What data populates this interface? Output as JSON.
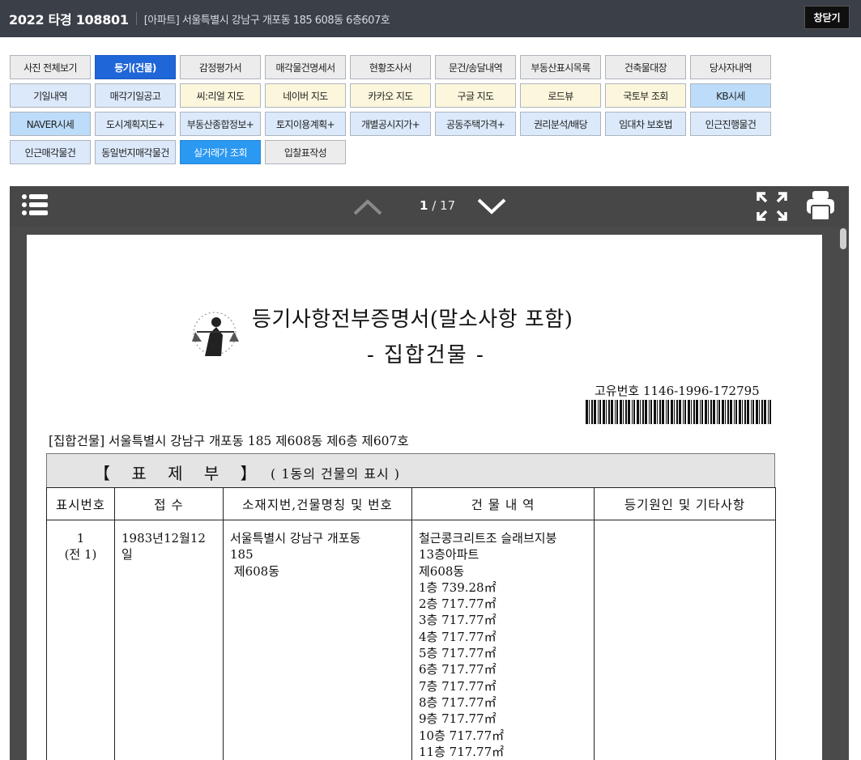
{
  "header": {
    "case_no": "2022 타경 108801",
    "address": "[아파트] 서울특별시 강남구 개포동 185 608동 6층607호",
    "close_label": "창닫기"
  },
  "menu": {
    "rows": [
      [
        {
          "label": "사진 전체보기",
          "style": "plain"
        },
        {
          "label": "등기(건물)",
          "style": "active"
        },
        {
          "label": "감정평가서",
          "style": "plain"
        },
        {
          "label": "매각물건명세서",
          "style": "plain"
        },
        {
          "label": "현황조사서",
          "style": "plain"
        },
        {
          "label": "문건/송달내역",
          "style": "plain"
        },
        {
          "label": "부동산표시목록",
          "style": "plain"
        },
        {
          "label": "건축물대장",
          "style": "plain"
        },
        {
          "label": "당사자내역",
          "style": "plain"
        }
      ],
      [
        {
          "label": "기일내역",
          "style": "blue"
        },
        {
          "label": "매각기일공고",
          "style": "blue"
        },
        {
          "label": "씨:리얼 지도",
          "style": "yellow"
        },
        {
          "label": "네이버 지도",
          "style": "yellow"
        },
        {
          "label": "카카오 지도",
          "style": "yellow"
        },
        {
          "label": "구글 지도",
          "style": "yellow"
        },
        {
          "label": "로드뷰",
          "style": "yellow"
        },
        {
          "label": "국토부 조회",
          "style": "yellow"
        },
        {
          "label": "KB시세",
          "style": "sky"
        }
      ],
      [
        {
          "label": "NAVER시세",
          "style": "sky"
        },
        {
          "label": "도시계획지도+",
          "style": "blue"
        },
        {
          "label": "부동산종합정보+",
          "style": "blue"
        },
        {
          "label": "토지이용계획+",
          "style": "blue"
        },
        {
          "label": "개별공시지가+",
          "style": "blue"
        },
        {
          "label": "공동주택가격+",
          "style": "blue"
        },
        {
          "label": "권리분석/배당",
          "style": "blue"
        },
        {
          "label": "임대차 보호법",
          "style": "blue"
        },
        {
          "label": "인근진행물건",
          "style": "blue"
        }
      ],
      [
        {
          "label": "인근매각물건",
          "style": "blue"
        },
        {
          "label": "동일번지매각물건",
          "style": "blue"
        },
        {
          "label": "실거래가 조회",
          "style": "bright"
        },
        {
          "label": "입찰표작성",
          "style": "plain"
        }
      ]
    ]
  },
  "viewer": {
    "page_current": "1",
    "page_total": "/ 17",
    "icons": [
      "list-icon",
      "chevron-up-icon",
      "chevron-down-icon",
      "fullscreen-icon",
      "print-icon"
    ]
  },
  "document": {
    "title": "등기사항전부증명서(말소사항 포함)",
    "subtitle": "- 집합건물 -",
    "unique_no": "고유번호 1146-1996-172795",
    "property": "[집합건물] 서울특별시 강남구 개포동 185 제608동 제6층 제607호",
    "section_title": "【 표 제 부 】",
    "section_note": "( 1동의 건물의 표시 )",
    "columns": [
      "표시번호",
      "접 수",
      "소재지번,건물명칭 및 번호",
      "건 물 내 역",
      "등기원인 및 기타사항"
    ],
    "row": {
      "num": [
        "1",
        "(전 1)"
      ],
      "received": "1983년12월12일",
      "location": [
        "서울특별시 강남구 개포동",
        "185",
        " 제608동"
      ],
      "details": [
        "철근콩크리트조 슬래브지붕",
        "13층아파트",
        "제608동",
        "1층 739.28㎡",
        "2층 717.77㎡",
        "3층 717.77㎡",
        "4층 717.77㎡",
        "5층 717.77㎡",
        "6층 717.77㎡",
        "7층 717.77㎡",
        "8층 717.77㎡",
        "9층 717.77㎡",
        "10층 717.77㎡",
        "11층 717.77㎡"
      ],
      "cause": ""
    }
  }
}
